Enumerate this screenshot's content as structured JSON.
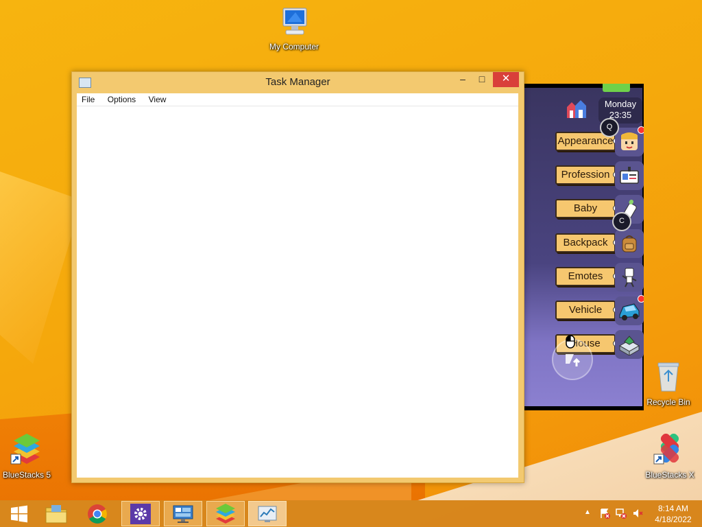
{
  "desktop": {
    "icons": [
      {
        "label": "My Computer"
      },
      {
        "label": "Recycle Bin"
      },
      {
        "label": "BlueStacks 5"
      },
      {
        "label": "BlueStacks X"
      }
    ]
  },
  "window": {
    "title": "Task Manager",
    "controls": {
      "minimize": "–",
      "maximize": "□",
      "close": "✕"
    },
    "menu": [
      "File",
      "Options",
      "View"
    ]
  },
  "game": {
    "day": "Monday",
    "time": "23:35",
    "keys": {
      "q": "Q",
      "c": "C"
    },
    "menu_items": [
      {
        "label": "Appearance",
        "icon": "face-icon"
      },
      {
        "label": "Profession",
        "icon": "id-card-icon"
      },
      {
        "label": "Baby",
        "icon": "baby-bottle-icon"
      },
      {
        "label": "Backpack",
        "icon": "backpack-icon"
      },
      {
        "label": "Emotes",
        "icon": "emote-character-icon"
      },
      {
        "label": "Vehicle",
        "icon": "car-icon"
      },
      {
        "label": "House",
        "icon": "house-icon"
      }
    ]
  },
  "taskbar": {
    "items": [
      "start-icon",
      "file-explorer-icon",
      "chrome-icon",
      "settings-icon",
      "remote-desktop-icon",
      "bluestacks-icon",
      "task-manager-icon"
    ],
    "tray": {
      "time": "8:14 AM",
      "date": "4/18/2022"
    }
  },
  "colors": {
    "accent": "#f3c96f",
    "close": "#d9403a",
    "button": "#f6c76f"
  }
}
